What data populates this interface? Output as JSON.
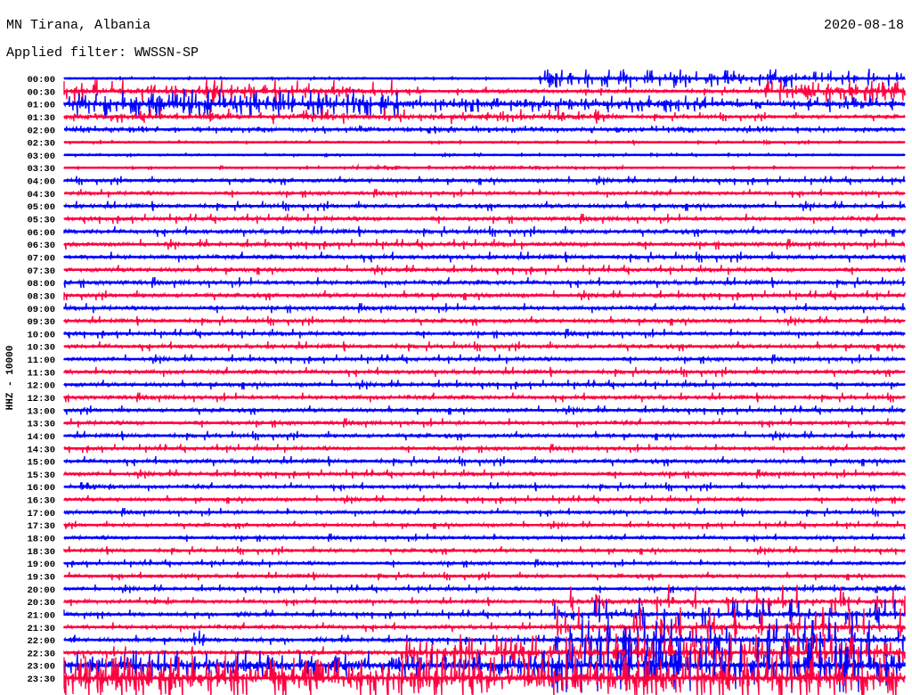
{
  "header": {
    "station": "MN Tirana, Albania",
    "filter": "Applied filter: WWSSN-SP",
    "date": "2020-08-18"
  },
  "chart_data": {
    "type": "line",
    "title": "MN Tirana, Albania",
    "ylabel": "HHZ - 10000",
    "x_span_minutes": 30,
    "colors": [
      "#0000ff",
      "#ff0040"
    ],
    "rows": [
      {
        "label": "00:00",
        "noise": 1.2,
        "events": [
          [
            17,
            30,
            9,
            0.25
          ]
        ]
      },
      {
        "label": "00:30",
        "noise": 2.5,
        "events": [
          [
            0,
            12,
            12,
            0.15
          ],
          [
            25,
            30,
            10,
            0.35
          ]
        ]
      },
      {
        "label": "01:00",
        "noise": 3,
        "events": [
          [
            0,
            12,
            14,
            0.3
          ],
          [
            12,
            30,
            8,
            0.15
          ]
        ]
      },
      {
        "label": "01:30",
        "noise": 2.5,
        "events": [
          [
            0,
            20,
            8,
            0.1
          ]
        ]
      },
      {
        "label": "02:00",
        "noise": 1.8,
        "events": [
          [
            0,
            30,
            4,
            0.05
          ]
        ]
      },
      {
        "label": "02:30",
        "noise": 1.3,
        "events": []
      },
      {
        "label": "03:00",
        "noise": 1.2,
        "events": []
      },
      {
        "label": "03:30",
        "noise": 1.2,
        "events": [
          [
            10,
            20,
            2,
            0.05
          ]
        ]
      },
      {
        "label": "04:00",
        "noise": 2.5,
        "events": [
          [
            17,
            18.5,
            4,
            0
          ]
        ]
      },
      {
        "label": "04:30",
        "noise": 2.4,
        "events": [
          [
            23,
            24,
            3,
            0
          ]
        ]
      },
      {
        "label": "05:00",
        "noise": 2.8,
        "events": [
          [
            21,
            23,
            3,
            0
          ]
        ]
      },
      {
        "label": "05:30",
        "noise": 2.8,
        "events": [
          [
            2.5,
            3.5,
            4,
            0
          ]
        ]
      },
      {
        "label": "06:00",
        "noise": 3,
        "events": [
          [
            9,
            10,
            5,
            0
          ]
        ]
      },
      {
        "label": "06:30",
        "noise": 3,
        "events": []
      },
      {
        "label": "07:00",
        "noise": 3,
        "events": [
          [
            19,
            21,
            4,
            0
          ]
        ]
      },
      {
        "label": "07:30",
        "noise": 2.8,
        "events": []
      },
      {
        "label": "08:00",
        "noise": 3,
        "events": [
          [
            11,
            13,
            3,
            0
          ]
        ]
      },
      {
        "label": "08:30",
        "noise": 2.8,
        "events": []
      },
      {
        "label": "09:00",
        "noise": 2.8,
        "events": []
      },
      {
        "label": "09:30",
        "noise": 2.7,
        "events": []
      },
      {
        "label": "10:00",
        "noise": 2.7,
        "events": []
      },
      {
        "label": "10:30",
        "noise": 2.8,
        "events": []
      },
      {
        "label": "11:00",
        "noise": 2.6,
        "events": []
      },
      {
        "label": "11:30",
        "noise": 2.8,
        "events": []
      },
      {
        "label": "12:00",
        "noise": 2.7,
        "events": []
      },
      {
        "label": "12:30",
        "noise": 2.7,
        "events": []
      },
      {
        "label": "13:00",
        "noise": 2.6,
        "events": [
          [
            18.5,
            19.5,
            3,
            0
          ]
        ]
      },
      {
        "label": "13:30",
        "noise": 2.6,
        "events": []
      },
      {
        "label": "14:00",
        "noise": 2.6,
        "events": []
      },
      {
        "label": "14:30",
        "noise": 2.5,
        "events": []
      },
      {
        "label": "15:00",
        "noise": 2.8,
        "events": [
          [
            4,
            8,
            3,
            0
          ]
        ]
      },
      {
        "label": "15:30",
        "noise": 2.6,
        "events": [
          [
            1.2,
            2.5,
            3,
            0
          ]
        ]
      },
      {
        "label": "16:00",
        "noise": 2.5,
        "events": [
          [
            0.6,
            3.3,
            10,
            0
          ],
          [
            3.3,
            4,
            4,
            0
          ]
        ]
      },
      {
        "label": "16:30",
        "noise": 2.4,
        "events": []
      },
      {
        "label": "17:00",
        "noise": 2.4,
        "events": []
      },
      {
        "label": "17:30",
        "noise": 2.3,
        "events": []
      },
      {
        "label": "18:00",
        "noise": 2.3,
        "events": []
      },
      {
        "label": "18:30",
        "noise": 2.4,
        "events": [
          [
            14.5,
            15.5,
            3,
            0
          ]
        ]
      },
      {
        "label": "19:00",
        "noise": 2.3,
        "events": []
      },
      {
        "label": "19:30",
        "noise": 2.4,
        "events": []
      },
      {
        "label": "20:00",
        "noise": 2.4,
        "events": [
          [
            7,
            7.5,
            4,
            0
          ],
          [
            24,
            30,
            4,
            0.05
          ]
        ]
      },
      {
        "label": "20:30",
        "noise": 2.5,
        "events": [
          [
            18,
            30,
            18,
            0.06
          ]
        ]
      },
      {
        "label": "21:00",
        "noise": 2.6,
        "events": [
          [
            17.5,
            30,
            16,
            0.1
          ]
        ]
      },
      {
        "label": "21:30",
        "noise": 2.7,
        "events": [
          [
            12.5,
            13.5,
            4,
            0
          ],
          [
            17.5,
            30,
            20,
            0.12
          ]
        ]
      },
      {
        "label": "22:00",
        "noise": 2.8,
        "events": [
          [
            4.5,
            5,
            10,
            0.3
          ],
          [
            17.5,
            30,
            24,
            0.15
          ]
        ]
      },
      {
        "label": "22:30",
        "noise": 3.5,
        "events": [
          [
            12,
            30,
            18,
            0.25
          ]
        ]
      },
      {
        "label": "23:00",
        "noise": 4.5,
        "events": [
          [
            0,
            17,
            14,
            0.2
          ],
          [
            17,
            30,
            26,
            0.3
          ]
        ]
      },
      {
        "label": "23:30",
        "noise": 5,
        "events": [
          [
            0,
            30,
            22,
            0.3
          ]
        ]
      }
    ]
  }
}
